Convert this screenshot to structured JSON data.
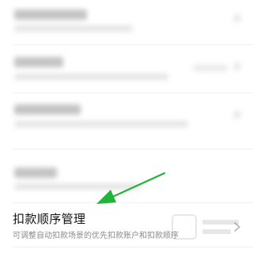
{
  "settings": {
    "blurred_items": [
      {
        "name": "blurred-item-1"
      },
      {
        "name": "blurred-item-2"
      },
      {
        "name": "blurred-item-3"
      },
      {
        "name": "blurred-item-4"
      }
    ],
    "deduction_order": {
      "title": "扣款顺序管理",
      "subtitle": "可调整自动扣款场景的优先扣款账户和扣款顺序",
      "icon": "chevron-right-icon"
    }
  },
  "annotation": {
    "arrow_color": "#22b33a",
    "icon": "arrow-icon"
  },
  "colors": {
    "background": "#ffffff",
    "title": "#111111",
    "subtitle": "#8c8c8c",
    "divider": "#f1f1f1"
  }
}
